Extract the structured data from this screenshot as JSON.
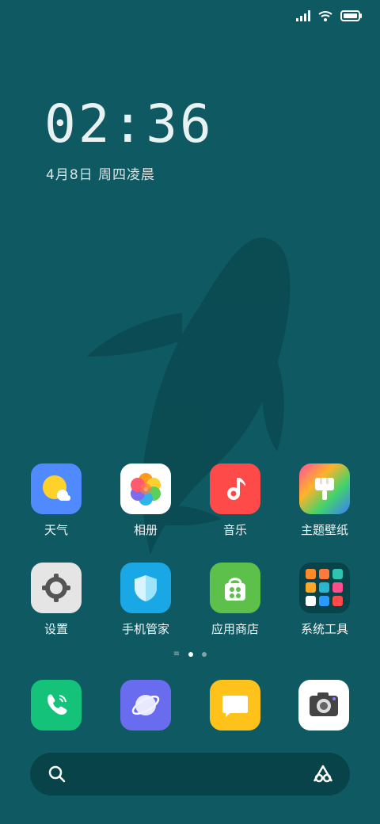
{
  "colors": {
    "wallpaper": "#0f5a62",
    "weather": "#4f8bff",
    "music": "#ff4a4a",
    "manager": "#1aa7e6",
    "store": "#5cc04a",
    "phone": "#14c27a",
    "browser": "#6a6cf0",
    "messages": "#ffc21a"
  },
  "lock": {
    "time": "02:36",
    "date": "4月8日 周四凌晨"
  },
  "apps": [
    {
      "label": "天气",
      "icon": "weather-icon"
    },
    {
      "label": "相册",
      "icon": "gallery-icon"
    },
    {
      "label": "音乐",
      "icon": "music-icon"
    },
    {
      "label": "主题壁纸",
      "icon": "theme-icon"
    },
    {
      "label": "设置",
      "icon": "gear-icon"
    },
    {
      "label": "手机管家",
      "icon": "shield-icon"
    },
    {
      "label": "应用商店",
      "icon": "store-icon"
    },
    {
      "label": "系统工具",
      "icon": "folder-icon"
    }
  ],
  "dock": [
    {
      "icon": "phone-icon"
    },
    {
      "icon": "browser-icon"
    },
    {
      "icon": "message-icon"
    },
    {
      "icon": "camera-icon"
    }
  ],
  "page_indicator": {
    "pages": 2,
    "current": 1
  }
}
